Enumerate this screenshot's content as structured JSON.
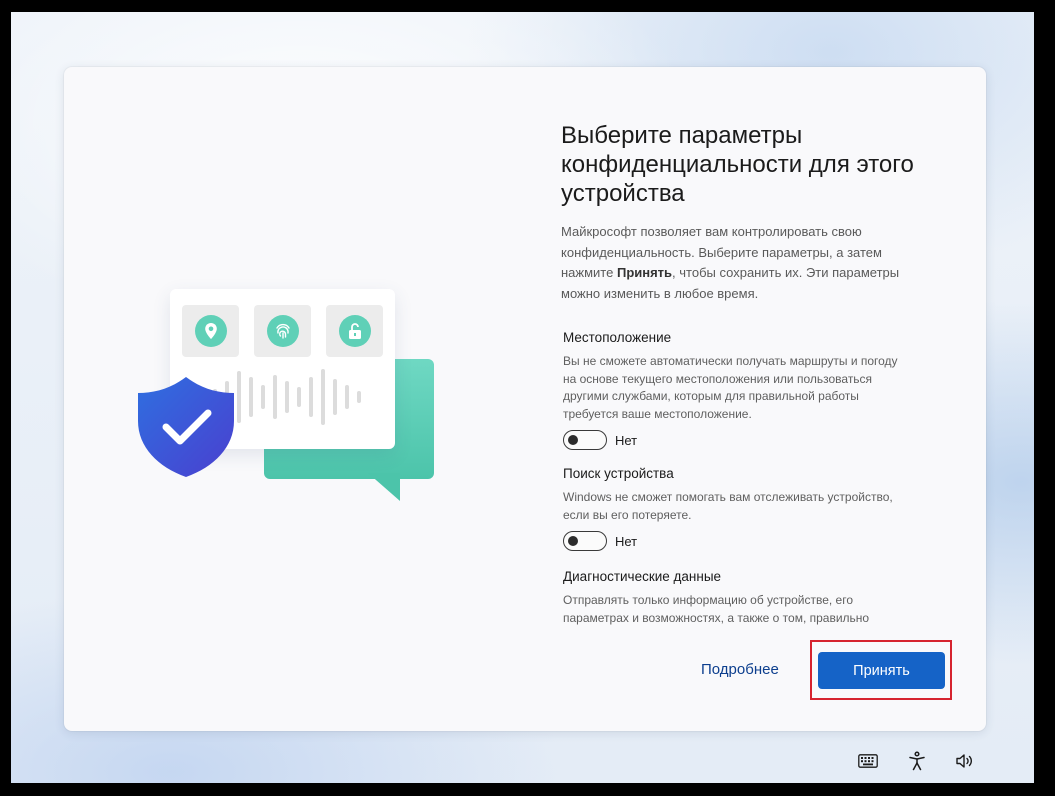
{
  "title": "Выберите параметры конфиденциальности для этого устройства",
  "intro": {
    "before": "Майкрософт позволяет вам контролировать свою конфиденциальность. Выберите параметры, а затем нажмите ",
    "bold": "Принять",
    "after": ", чтобы сохранить их. Эти параметры можно изменить в любое время."
  },
  "sections": [
    {
      "title": "Местоположение",
      "desc": "Вы не сможете автоматически получать маршруты и погоду на основе текущего местоположения или пользоваться другими службами, которым для правильной работы требуется ваше местоположение.",
      "toggle_state": "Нет"
    },
    {
      "title": "Поиск устройства",
      "desc": "Windows не сможет помогать вам отслеживать устройство, если вы его потеряете.",
      "toggle_state": "Нет"
    },
    {
      "title": "Диагностические данные",
      "desc": "Отправлять только информацию об устройстве, его параметрах и возможностях, а также о том, правильно"
    }
  ],
  "buttons": {
    "learn_more": "Подробнее",
    "accept": "Принять"
  },
  "illustration_icons": [
    "location-icon",
    "fingerprint-icon",
    "unlock-icon",
    "shield-check-icon"
  ],
  "tray_icons": [
    "keyboard-icon",
    "accessibility-icon",
    "volume-icon"
  ],
  "colors": {
    "accent": "#1563c7",
    "highlight_border": "#d6232f",
    "teal": "#4cc4aa",
    "shield": "#3f5bd8"
  }
}
